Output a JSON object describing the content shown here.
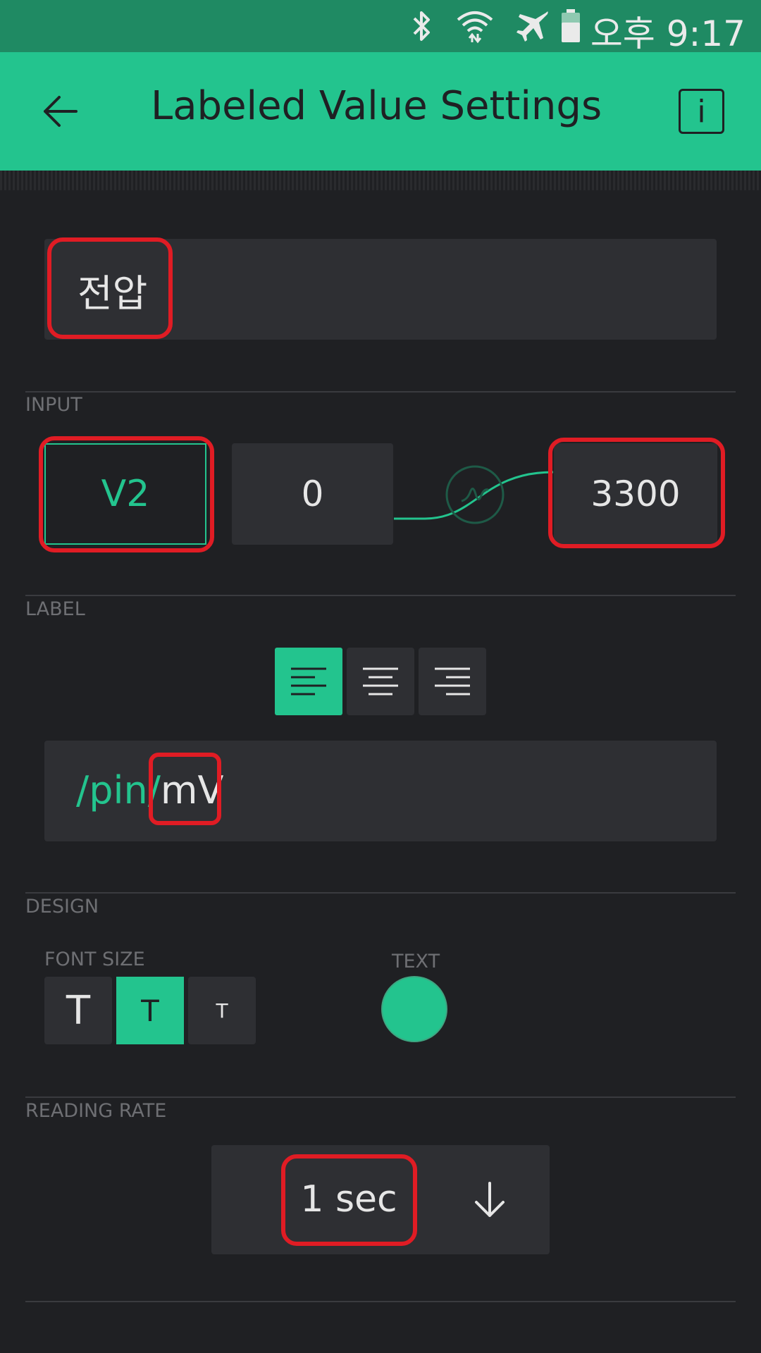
{
  "status_bar": {
    "time": "오후 9:17",
    "icons": [
      "bluetooth-icon",
      "wifi-icon",
      "airplane-icon",
      "battery-icon"
    ]
  },
  "app_bar": {
    "title": "Labeled Value Settings",
    "back_icon": "back-arrow-icon",
    "info_label": "i"
  },
  "widget_name": {
    "value": "전압"
  },
  "input": {
    "section_label": "INPUT",
    "pin": "V2",
    "min": "0",
    "max": "3300"
  },
  "label": {
    "section_label": "LABEL",
    "alignment_options": [
      "align-left",
      "align-center",
      "align-right"
    ],
    "selected_alignment": "align-left",
    "prefix": "/pin/",
    "suffix": "mV"
  },
  "design": {
    "section_label": "DESIGN",
    "font_size_label": "FONT SIZE",
    "font_sizes": [
      "T",
      "T",
      "T"
    ],
    "selected_font_size_index": 1,
    "text_color_label": "TEXT",
    "text_color": "#23c48e"
  },
  "reading_rate": {
    "section_label": "READING RATE",
    "value": "1 sec"
  },
  "colors": {
    "accent": "#23c48e",
    "background": "#1f2023",
    "field": "#2e2f33",
    "highlight": "#e01c24"
  }
}
